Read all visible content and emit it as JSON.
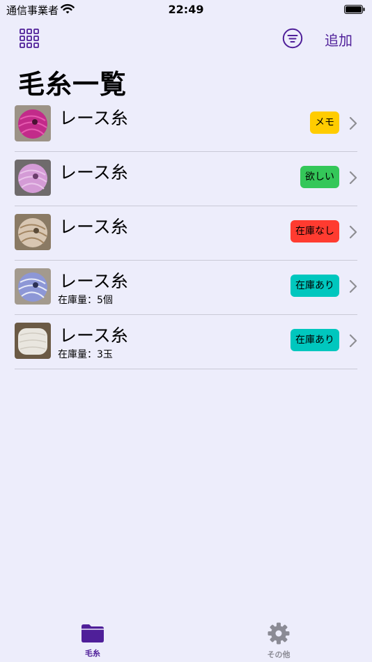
{
  "status_bar": {
    "carrier": "通信事業者",
    "time": "22:49"
  },
  "nav": {
    "grid_icon": "grid-icon",
    "filter_icon": "filter-icon",
    "add_label": "追加",
    "accent_color": "#4f1f99"
  },
  "page": {
    "title": "毛糸一覧"
  },
  "yarns": [
    {
      "name": "レース糸",
      "stock": "",
      "status": "メモ",
      "status_color": "#ffcc00",
      "thumb_color": "#c22b8a"
    },
    {
      "name": "レース糸",
      "stock": "",
      "status": "欲しい",
      "status_color": "#34c759",
      "thumb_color": "#d49bd6"
    },
    {
      "name": "レース糸",
      "stock": "",
      "status": "在庫なし",
      "status_color": "#ff3b30",
      "thumb_color": "#d8c6b2"
    },
    {
      "name": "レース糸",
      "stock": "在庫量：5個",
      "status": "在庫あり",
      "status_color": "#00c7be",
      "thumb_color": "#8d97d6"
    },
    {
      "name": "レース糸",
      "stock": "在庫量：3玉",
      "status": "在庫あり",
      "status_color": "#00c7be",
      "thumb_color": "#e9e6df"
    }
  ],
  "tabbar": {
    "items": [
      {
        "label": "毛糸",
        "icon": "folder-icon",
        "active": true
      },
      {
        "label": "その他",
        "icon": "gear-icon",
        "active": false
      }
    ]
  }
}
